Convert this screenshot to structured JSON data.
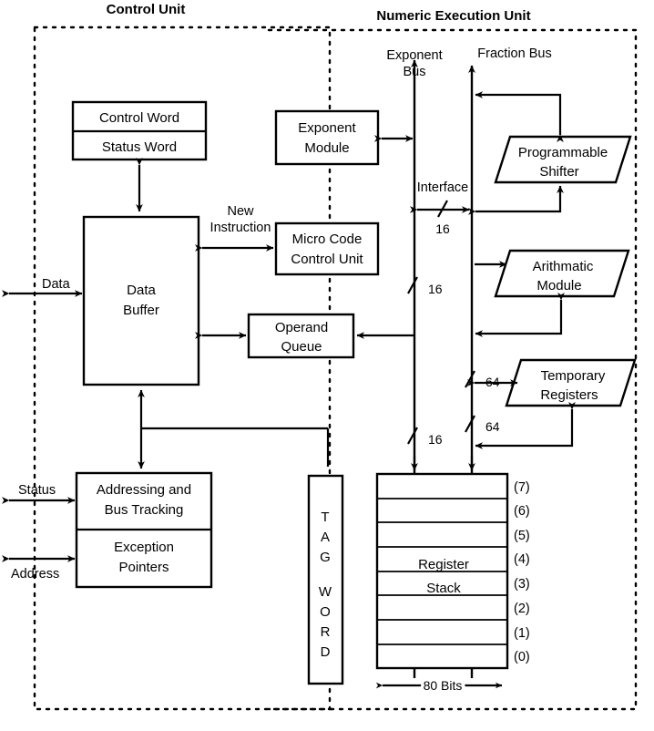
{
  "figure": {
    "type": "block-diagram",
    "title_left": "Control Unit",
    "title_right": "Numeric Execution Unit"
  },
  "buses": {
    "exponent": "Exponent\nBus",
    "exponent_line1": "Exponent",
    "exponent_line2": "Bus",
    "fraction": "Fraction Bus",
    "interface": "Interface"
  },
  "blocks": {
    "control_word": "Control Word",
    "status_word": "Status Word",
    "data_buffer_line1": "Data",
    "data_buffer_line2": "Buffer",
    "addressing_line1": "Addressing and",
    "addressing_line2": "Bus Tracking",
    "exception_line1": "Exception",
    "exception_line2": "Pointers",
    "exponent_module_line1": "Exponent",
    "exponent_module_line2": "Module",
    "microcode_line1": "Micro Code",
    "microcode_line2": "Control Unit",
    "operand_queue_line1": "Operand",
    "operand_queue_line2": "Queue",
    "programmable_shifter_line1": "Programmable",
    "programmable_shifter_line2": "Shifter",
    "arithmatic_module_line1": "Arithmatic",
    "arithmatic_module_line2": "Module",
    "temporary_registers_line1": "Temporary",
    "temporary_registers_line2": "Registers",
    "register_stack_line1": "Register",
    "register_stack_line2": "Stack",
    "tag_word_letters": [
      "T",
      "A",
      "G",
      "W",
      "O",
      "R",
      "D"
    ]
  },
  "edge_labels": {
    "data": "Data",
    "status": "Status",
    "address": "Address",
    "new_instruction_line1": "New",
    "new_instruction_line2": "Instruction"
  },
  "bus_widths": {
    "interface_16": "16",
    "exp_mid_16": "16",
    "exp_low_16": "16",
    "frac_64_upper": "64",
    "frac_64_lower": "64"
  },
  "register_stack": {
    "indices": [
      "(7)",
      "(6)",
      "(5)",
      "(4)",
      "(3)",
      "(2)",
      "(1)",
      "(0)"
    ],
    "width_label": "80 Bits"
  },
  "colors": {
    "ink": "#000000",
    "paper": "#ffffff"
  }
}
